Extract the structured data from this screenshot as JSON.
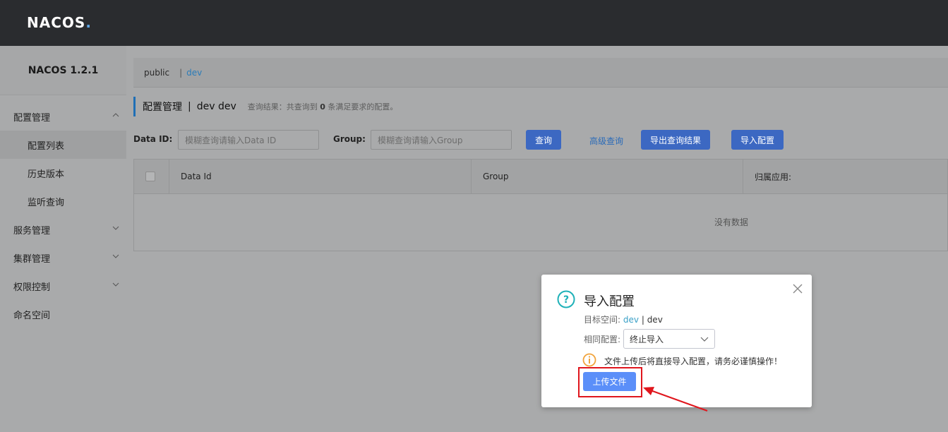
{
  "header": {
    "logo_text": "NACOS"
  },
  "sidebar": {
    "version": "NACOS 1.2.1",
    "items": [
      {
        "label": "配置管理",
        "expanded": true
      },
      {
        "label": "配置列表",
        "sub": true,
        "active": true
      },
      {
        "label": "历史版本",
        "sub": true
      },
      {
        "label": "监听查询",
        "sub": true
      },
      {
        "label": "服务管理",
        "expanded": false
      },
      {
        "label": "集群管理",
        "expanded": false
      },
      {
        "label": "权限控制",
        "expanded": false
      },
      {
        "label": "命名空间"
      }
    ]
  },
  "namespace_bar": {
    "public": "public",
    "separator": "|",
    "dev": "dev"
  },
  "page_title": {
    "title": "配置管理",
    "separator": "|",
    "ns": "dev  dev",
    "result_prefix": "查询结果：共查询到",
    "result_count": "0",
    "result_suffix": "条满足要求的配置。"
  },
  "search": {
    "dataid_label": "Data ID:",
    "dataid_placeholder": "模糊查询请输入Data ID",
    "group_label": "Group:",
    "group_placeholder": "模糊查询请输入Group",
    "query_button": "查询",
    "advanced_link": "高级查询",
    "export_button": "导出查询结果",
    "import_button": "导入配置"
  },
  "table": {
    "columns": [
      "Data Id",
      "Group",
      "归属应用:"
    ],
    "empty_text": "没有数据"
  },
  "dialog": {
    "title": "导入配置",
    "target_label": "目标空间:",
    "target_ns": "dev",
    "target_sep": "|",
    "target_id": "dev",
    "same_config_label": "相同配置:",
    "same_config_value": "终止导入",
    "warning": "文件上传后将直接导入配置，请务必谨慎操作！",
    "upload_button": "上传文件"
  },
  "colors": {
    "primary": "#3c68c2",
    "upload": "#5b8ff9",
    "highlight": "#e0161d",
    "topbar": "#2a2c2f"
  }
}
